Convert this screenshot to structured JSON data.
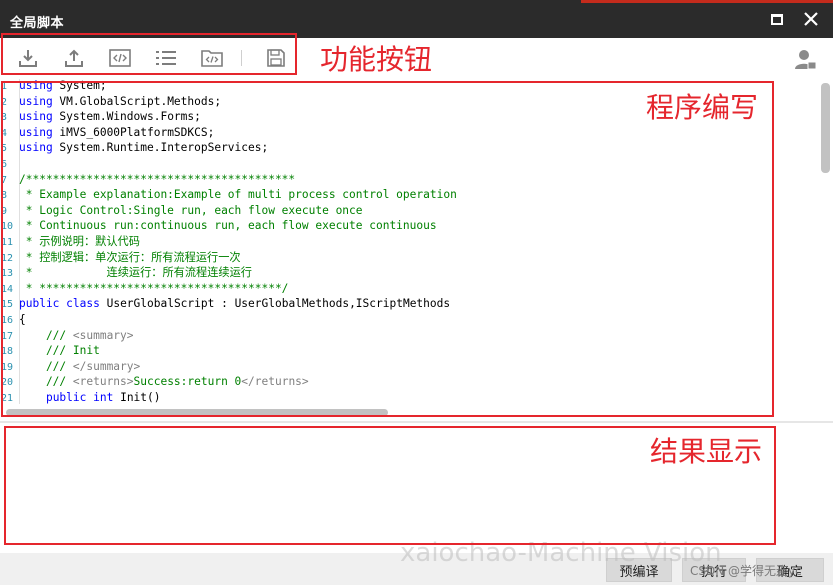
{
  "window": {
    "title": "全局脚本",
    "maximize_icon": "maximize-icon",
    "close_icon": "close-icon"
  },
  "toolbar": {
    "buttons": [
      {
        "icon": "import-icon"
      },
      {
        "icon": "export-icon"
      },
      {
        "icon": "code-icon"
      },
      {
        "icon": "list-icon"
      },
      {
        "icon": "code-folder-icon"
      },
      {
        "icon": "save-icon"
      }
    ],
    "user_icon": "user-icon"
  },
  "annotations": {
    "toolbar_label": "功能按钮",
    "editor_label": "程序编写",
    "result_label": "结果显示",
    "color": "#e5262d"
  },
  "editor": {
    "lines": [
      {
        "num": "1",
        "text": "using System;"
      },
      {
        "num": "2",
        "text": "using VM.GlobalScript.Methods;"
      },
      {
        "num": "3",
        "text": "using System.Windows.Forms;"
      },
      {
        "num": "4",
        "text": "using iMVS_6000PlatformSDKCS;"
      },
      {
        "num": "5",
        "text": "using System.Runtime.InteropServices;"
      },
      {
        "num": "6",
        "text": ""
      },
      {
        "num": "7",
        "text": "/****************************************"
      },
      {
        "num": "8",
        "text": " * Example explanation:Example of multi process control operation"
      },
      {
        "num": "9",
        "text": " * Logic Control:Single run, each flow execute once"
      },
      {
        "num": "10",
        "text": " * Continuous run:continuous run, each flow execute continuous"
      },
      {
        "num": "11",
        "text": " * 示例说明：默认代码"
      },
      {
        "num": "12",
        "text": " * 控制逻辑：单次运行：所有流程运行一次"
      },
      {
        "num": "13",
        "text": " *           连续运行：所有流程连续运行"
      },
      {
        "num": "14",
        "text": " * ************************************/"
      },
      {
        "num": "15",
        "text": "public class UserGlobalScript : UserGlobalMethods,IScriptMethods"
      },
      {
        "num": "16",
        "text": "{"
      },
      {
        "num": "17",
        "text": "    /// <summary>"
      },
      {
        "num": "18",
        "text": "    /// Init"
      },
      {
        "num": "19",
        "text": "    /// </summary>"
      },
      {
        "num": "20",
        "text": "    /// <returns>Success:return 0</returns>"
      },
      {
        "num": "21",
        "text": "    public int Init()"
      }
    ]
  },
  "footer": {
    "precompile_label": "预编译",
    "run_label": "执行",
    "ok_label": "确定",
    "watermark": "xaiochao-Machine Vision",
    "csdn_mark": "CSDN @学得无连yc"
  }
}
